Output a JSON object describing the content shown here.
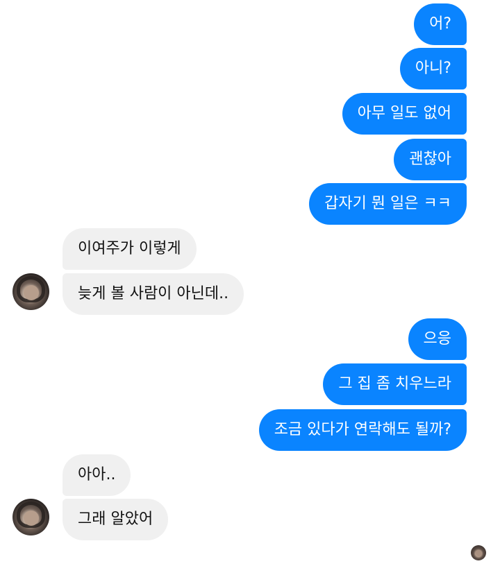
{
  "colors": {
    "outgoing_bubble": "#0a84ff",
    "incoming_bubble": "#f0f0f0",
    "outgoing_text": "#ffffff",
    "incoming_text": "#111111"
  },
  "messages": {
    "out1": [
      "어?",
      "아니?",
      "아무 일도 없어",
      "괜찮아",
      "갑자기 뭔 일은 ㅋㅋ"
    ],
    "in1": [
      "이여주가 이렇게",
      "늦게 볼 사람이 아닌데.."
    ],
    "out2": [
      "으응",
      "그 집 좀 치우느라",
      "조금 있다가 연락해도 될까?"
    ],
    "in2": [
      "아아..",
      "그래 알았어"
    ]
  },
  "avatars": {
    "contact": "contact-avatar",
    "seen_indicator": "seen-avatar"
  }
}
